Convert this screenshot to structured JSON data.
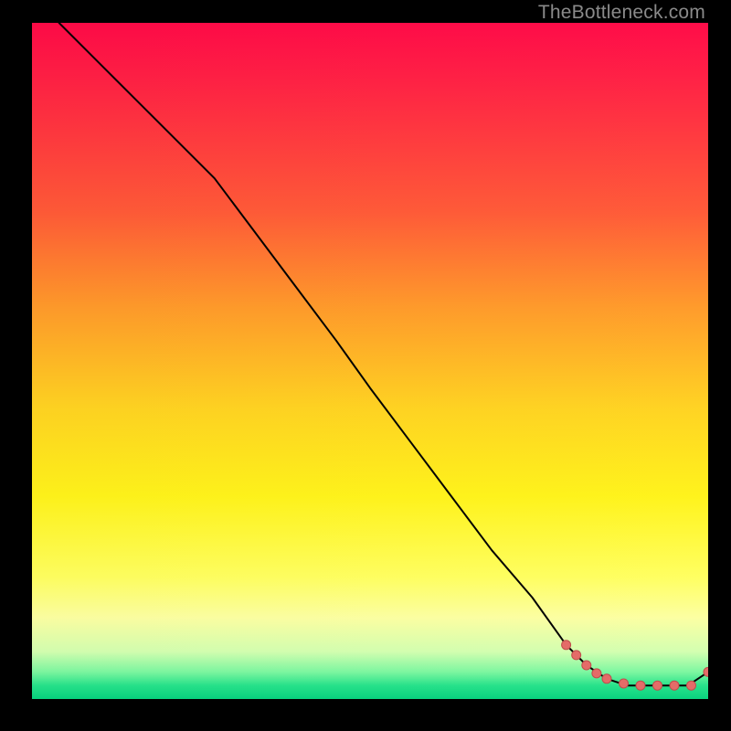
{
  "watermark": "TheBottleneck.com",
  "colors": {
    "point": "#e46a67",
    "point_stroke": "#bf4c4a",
    "line": "#000000"
  },
  "chart_data": {
    "type": "line",
    "title": "",
    "xlabel": "",
    "ylabel": "",
    "xlim": [
      0,
      100
    ],
    "ylim": [
      0,
      100
    ],
    "grid": false,
    "legend": false,
    "annotations": [],
    "series": [
      {
        "name": "curve",
        "style": "line",
        "x": [
          4,
          10,
          16,
          22,
          27,
          33,
          39,
          45,
          50,
          56,
          62,
          68,
          74,
          79,
          82,
          85,
          88,
          91,
          94,
          97,
          100
        ],
        "y": [
          100,
          94,
          88,
          82,
          77,
          69,
          61,
          53,
          46,
          38,
          30,
          22,
          15,
          8,
          5,
          3,
          2,
          2,
          2,
          2,
          4
        ]
      },
      {
        "name": "points",
        "style": "scatter",
        "x": [
          79.0,
          80.5,
          82.0,
          83.5,
          85.0,
          87.5,
          90.0,
          92.5,
          95.0,
          97.5,
          100.0
        ],
        "y": [
          8.0,
          6.5,
          5.0,
          3.8,
          3.0,
          2.3,
          2.0,
          2.0,
          2.0,
          2.0,
          4.0
        ]
      }
    ]
  }
}
